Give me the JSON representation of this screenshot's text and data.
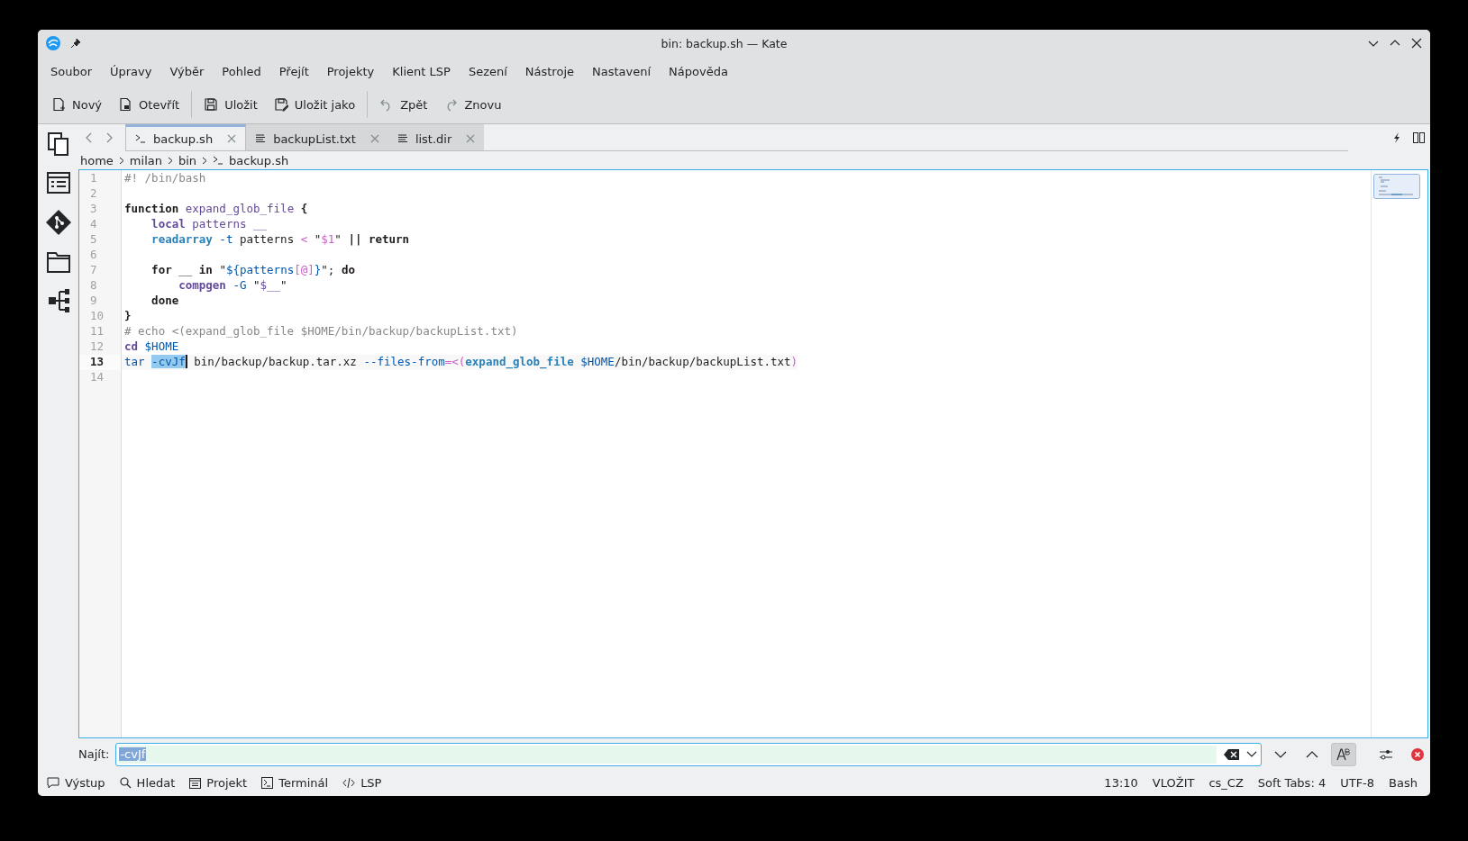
{
  "window": {
    "title": "bin: backup.sh — Kate"
  },
  "menu": [
    "Soubor",
    "Úpravy",
    "Výběr",
    "Pohled",
    "Přejít",
    "Projekty",
    "Klient LSP",
    "Sezení",
    "Nástroje",
    "Nastavení",
    "Nápověda"
  ],
  "toolbar": [
    [
      "Nový",
      "Otevřít"
    ],
    [
      "Uložit",
      "Uložit jako"
    ],
    [
      "Zpět",
      "Znovu"
    ]
  ],
  "tabs": [
    {
      "label": "backup.sh",
      "selected": true
    },
    {
      "label": "backupList.txt",
      "selected": false
    },
    {
      "label": "list.dir",
      "selected": false
    }
  ],
  "breadcrumb": [
    "home",
    "milan",
    "bin",
    "backup.sh"
  ],
  "editor": {
    "lines": [
      {
        "number": "1",
        "current": false,
        "tokens": [
          {
            "kind": "comment",
            "text": "#! /bin/bash"
          }
        ]
      },
      {
        "number": "2",
        "current": false
      },
      {
        "number": "3",
        "current": false,
        "tokens": [
          {
            "kind": "keyword",
            "text": "function"
          },
          {
            "kind": "name",
            "text": " expand_glob_file "
          },
          {
            "kind": "keyword",
            "text": "{"
          }
        ]
      },
      {
        "number": "4",
        "current": false,
        "tokens": [
          {
            "kind": "builtin",
            "text": "    local"
          },
          {
            "kind": "name",
            "text": " patterns __"
          }
        ]
      },
      {
        "number": "5",
        "current": false,
        "tokens": [
          {
            "kind": "command",
            "text": "    readarray"
          },
          {
            "kind": "option",
            "text": " -t"
          },
          {
            "kind": "plain",
            "text": " patterns "
          },
          {
            "kind": "operator",
            "text": "<"
          },
          {
            "kind": "plain",
            "text": " \""
          },
          {
            "kind": "operator",
            "text": "$1"
          },
          {
            "kind": "plain",
            "text": "\" "
          },
          {
            "kind": "keyword",
            "text": "|| return"
          }
        ]
      },
      {
        "number": "6",
        "current": false
      },
      {
        "number": "7",
        "current": false,
        "tokens": [
          {
            "kind": "keyword",
            "text": "    for"
          },
          {
            "kind": "plain",
            "text": " __ "
          },
          {
            "kind": "keyword",
            "text": "in"
          },
          {
            "kind": "plain",
            "text": " \""
          },
          {
            "kind": "variable",
            "text": "${patterns"
          },
          {
            "kind": "operator",
            "text": "[@]"
          },
          {
            "kind": "variable",
            "text": "}"
          },
          {
            "kind": "plain",
            "text": "\"; "
          },
          {
            "kind": "keyword",
            "text": "do"
          }
        ]
      },
      {
        "number": "8",
        "current": false,
        "tokens": [
          {
            "kind": "builtin",
            "text": "        compgen"
          },
          {
            "kind": "option",
            "text": " -G"
          },
          {
            "kind": "plain",
            "text": " \""
          },
          {
            "kind": "name",
            "text": "$__"
          },
          {
            "kind": "plain",
            "text": "\""
          }
        ]
      },
      {
        "number": "9",
        "current": false,
        "tokens": [
          {
            "kind": "keyword",
            "text": "    done"
          }
        ]
      },
      {
        "number": "10",
        "current": false,
        "tokens": [
          {
            "kind": "keyword",
            "text": "}"
          }
        ]
      },
      {
        "number": "11",
        "current": false,
        "tokens": [
          {
            "kind": "comment",
            "text": "# echo <(expand_glob_file $HOME/bin/backup/backupList.txt)"
          }
        ]
      },
      {
        "number": "12",
        "current": false,
        "tokens": [
          {
            "kind": "builtin",
            "text": "cd"
          },
          {
            "kind": "variable",
            "text": " $HOME"
          }
        ]
      },
      {
        "number": "13",
        "current": true,
        "tokens": [
          {
            "kind": "variable",
            "text": "tar "
          },
          {
            "kind": "selection",
            "text": "-cvJf",
            "cursor_after": true
          },
          {
            "kind": "plain",
            "text": " bin/backup/backup.tar.xz "
          },
          {
            "kind": "option",
            "text": "--files-from"
          },
          {
            "kind": "operator",
            "text": "=<("
          },
          {
            "kind": "command",
            "text": "expand_glob_file"
          },
          {
            "kind": "variable",
            "text": " $HOME"
          },
          {
            "kind": "plain",
            "text": "/bin/backup/backupList.txt"
          },
          {
            "kind": "operator",
            "text": ")"
          }
        ]
      },
      {
        "number": "14",
        "current": false
      }
    ]
  },
  "find": {
    "label": "Najít:",
    "value": "-cvJf",
    "match_case": true
  },
  "status_bar": {
    "tool_views": [
      "Výstup",
      "Hledat",
      "Projekt",
      "Terminál",
      "LSP"
    ],
    "info": [
      "13:10",
      "VLOŽIT",
      "cs_CZ",
      "Soft Tabs: 4",
      "UTF-8",
      "Bash"
    ]
  }
}
